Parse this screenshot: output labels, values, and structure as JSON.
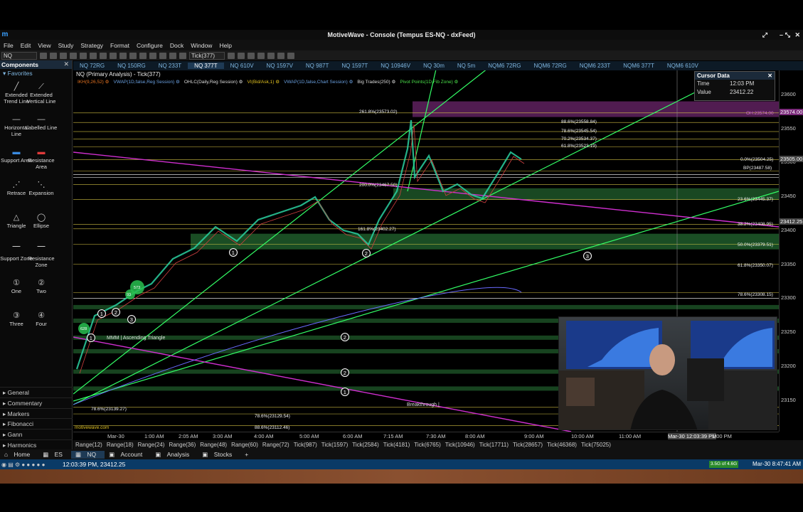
{
  "window": {
    "title": "MotiveWave - Console (Tempus ES-NQ - dxFeed)"
  },
  "menu": [
    "File",
    "Edit",
    "View",
    "Study",
    "Strategy",
    "Format",
    "Configure",
    "Dock",
    "Window",
    "Help"
  ],
  "toolbar": {
    "symbol": "NQ",
    "bar_type": "Tick(377)"
  },
  "chart_tabs": [
    "NQ 72RG",
    "NQ 150RG",
    "NQ 233T",
    "NQ 377T",
    "NQ 610V",
    "NQ 1597V",
    "NQ 987T",
    "NQ 1597T",
    "NQ 10946V",
    "NQ 30m",
    "NQ 5m",
    "NQM6 72RG",
    "NQM6 72RG",
    "NQM6 233T",
    "NQM6 377T",
    "NQM6 610V"
  ],
  "active_tab": "NQ 377T",
  "sidebar": {
    "title": "Components",
    "favorites": "Favorites",
    "tools": [
      {
        "label": "Extended Trend Line",
        "icon": "trend-line-icon"
      },
      {
        "label": "Extended Vertical Line",
        "icon": "vertical-line-icon"
      },
      {
        "label": "Horizontal Line",
        "icon": "horizontal-line-icon"
      },
      {
        "label": "Labelled Line",
        "icon": "labelled-line-icon"
      },
      {
        "label": "Support Area",
        "icon": "support-area-icon"
      },
      {
        "label": "Resistance Area",
        "icon": "resistance-area-icon"
      },
      {
        "label": "Retrace",
        "icon": "retrace-icon"
      },
      {
        "label": "Expansion",
        "icon": "expansion-icon"
      },
      {
        "label": "Triangle",
        "icon": "triangle-icon"
      },
      {
        "label": "Ellipse",
        "icon": "ellipse-icon"
      },
      {
        "label": "Support Zone",
        "icon": "support-zone-icon"
      },
      {
        "label": "Resistance Zone",
        "icon": "resistance-zone-icon"
      },
      {
        "label": "One",
        "icon": "circle-one-icon"
      },
      {
        "label": "Two",
        "icon": "circle-two-icon"
      },
      {
        "label": "Three",
        "icon": "circle-three-icon"
      },
      {
        "label": "Four",
        "icon": "circle-four-icon"
      }
    ],
    "categories": [
      "General",
      "Commentary",
      "Markers",
      "Fibonacci",
      "Gann",
      "Harmonics"
    ]
  },
  "chart": {
    "title": "NQ (Primary Analysis) - Tick(377)",
    "studies": [
      "IKH(9,26,52)",
      "VWAP(1D,false,Reg Session)",
      "OHLC(Daily,Reg Session)",
      "VI(Bid/Ask,1)",
      "VWAP(1D,false,Chart Session)",
      "Big Trades(250)",
      "Pivot Points(1D,Fib Zone)"
    ],
    "price_ticks": [
      "23600",
      "23550",
      "23500",
      "23450",
      "23400",
      "23350",
      "23300",
      "23250",
      "23200",
      "23150"
    ],
    "price_tags": {
      "oh": "OH:23574.00",
      "p1": "23574.00",
      "p2": "23505.00",
      "p3": "23412.25"
    },
    "time_ticks": [
      "Mar-30",
      "1:00 AM",
      "2:05 AM",
      "3:00 AM",
      "4:00 AM",
      "5:00 AM",
      "6:00 AM",
      "7:15 AM",
      "7:30 AM",
      "8:00 AM",
      "9:00 AM",
      "10:00 AM",
      "11:00 AM",
      "Mar-30 12:03:39 PM",
      "1:00 PM"
    ],
    "fib_labels": [
      "261.8%(23573.02)",
      "88.6%(23558.84)",
      "78.6%(23545.54)",
      "70.2%(23534.37)",
      "61.8%(23523.19)",
      "0.0%(23504.25)",
      "BP(23487.58)",
      "200.0%(23467.50)",
      "23.6%(23445.37)",
      "161.8%(23402.27)",
      "38.2%(23408.95)",
      "50.0%(23379.51)",
      "61.8%(23350.07)",
      "78.6%(23308.15)",
      "78.6%(23139.27)",
      "78.6%(23129.54)",
      "88.6%(23112.46)"
    ],
    "annotations": {
      "pattern": "MMM | Ascending Triangle",
      "breakthrough": "Breakthrough |",
      "watermark": "motivewave.com"
    },
    "bubbles": [
      "573",
      "628",
      "93"
    ]
  },
  "cursor_data": {
    "title": "Cursor Data",
    "time_label": "Time",
    "time_value": "12:03 PM",
    "value_label": "Value",
    "value_value": "23412.22"
  },
  "range_bar": [
    "Range(12)",
    "Range(18)",
    "Range(24)",
    "Range(36)",
    "Range(48)",
    "Range(60)",
    "Range(72)",
    "Tick(987)",
    "Tick(1597)",
    "Tick(2584)",
    "Tick(4181)",
    "Tick(6765)",
    "Tick(10946)",
    "Tick(17711)",
    "Tick(28657)",
    "Tick(46368)",
    "Tick(75025)"
  ],
  "workspace_tabs": [
    "Home",
    "ES",
    "NQ",
    "Account",
    "Analysis",
    "Stocks"
  ],
  "status": {
    "time_price": "12:03:39 PM, 23412.25",
    "memory": "3.5G of 4.6G",
    "right_time": "Mar-30 8:47:41 AM"
  },
  "colors": {
    "fib_yellow": "#e6d34a",
    "green_line": "#33ff66",
    "magenta_line": "#d02fd0",
    "support_zone": "#1f5a2a",
    "resistance_zone": "#5a1f5a",
    "accent": "#1e5fa0"
  }
}
